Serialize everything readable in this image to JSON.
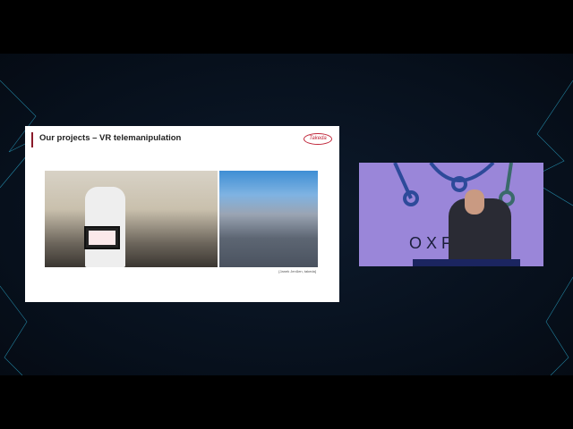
{
  "slide": {
    "title": "Our projects – VR telemanipulation",
    "logo_text": "Takeda",
    "caption": "[Janek Jenßen, takeda]"
  },
  "video": {
    "backdrop_text": "OXF"
  },
  "colors": {
    "accent": "#8a1a2a",
    "backdrop": "#9a86d9"
  }
}
